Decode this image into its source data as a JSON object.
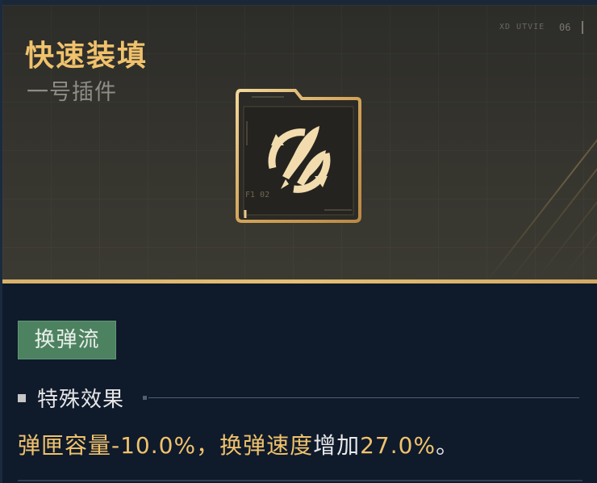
{
  "card": {
    "title": "快速装填",
    "subtitle": "一号插件",
    "corner_text": "XD UTVIE",
    "corner_num": "06",
    "icon_label": "F1 02",
    "icon": "rocket-reload-icon",
    "tag": "换弹流",
    "section_title": "特殊效果",
    "effect": {
      "part1": "弹匣容量",
      "part2": "-10.0%，",
      "part3": "换弹速度",
      "part4": "增加",
      "part5": "27.0%",
      "part6": "。"
    }
  },
  "colors": {
    "gold": "#f0c26c",
    "tag_green": "#4d8261",
    "panel_dark": "#0f1a2b",
    "header_dark": "#34332d"
  }
}
